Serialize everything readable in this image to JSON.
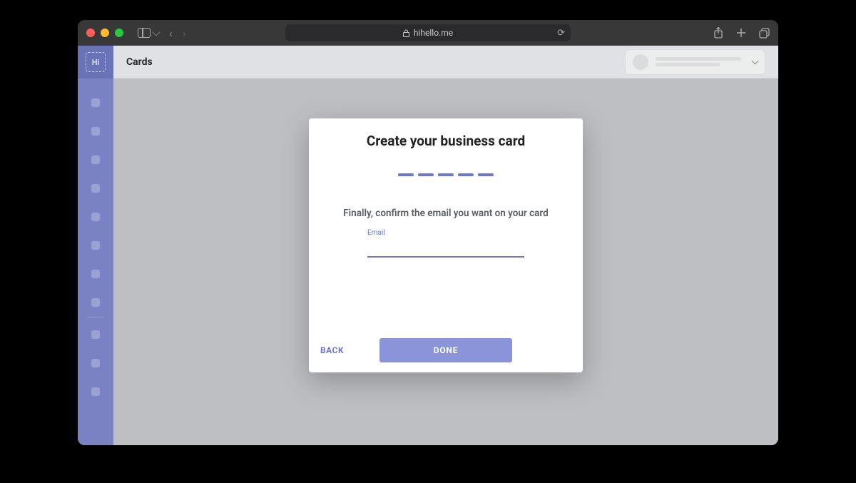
{
  "browser": {
    "url_display": "hihello.me"
  },
  "sidebar": {
    "logo_text": "Hi"
  },
  "topbar": {
    "title": "Cards"
  },
  "modal": {
    "title": "Create your business card",
    "prompt": "Finally, confirm the email you want on your card",
    "field_label": "Email",
    "field_value": "",
    "back_label": "BACK",
    "done_label": "DONE",
    "steps_total": 5,
    "steps_active": 5
  }
}
